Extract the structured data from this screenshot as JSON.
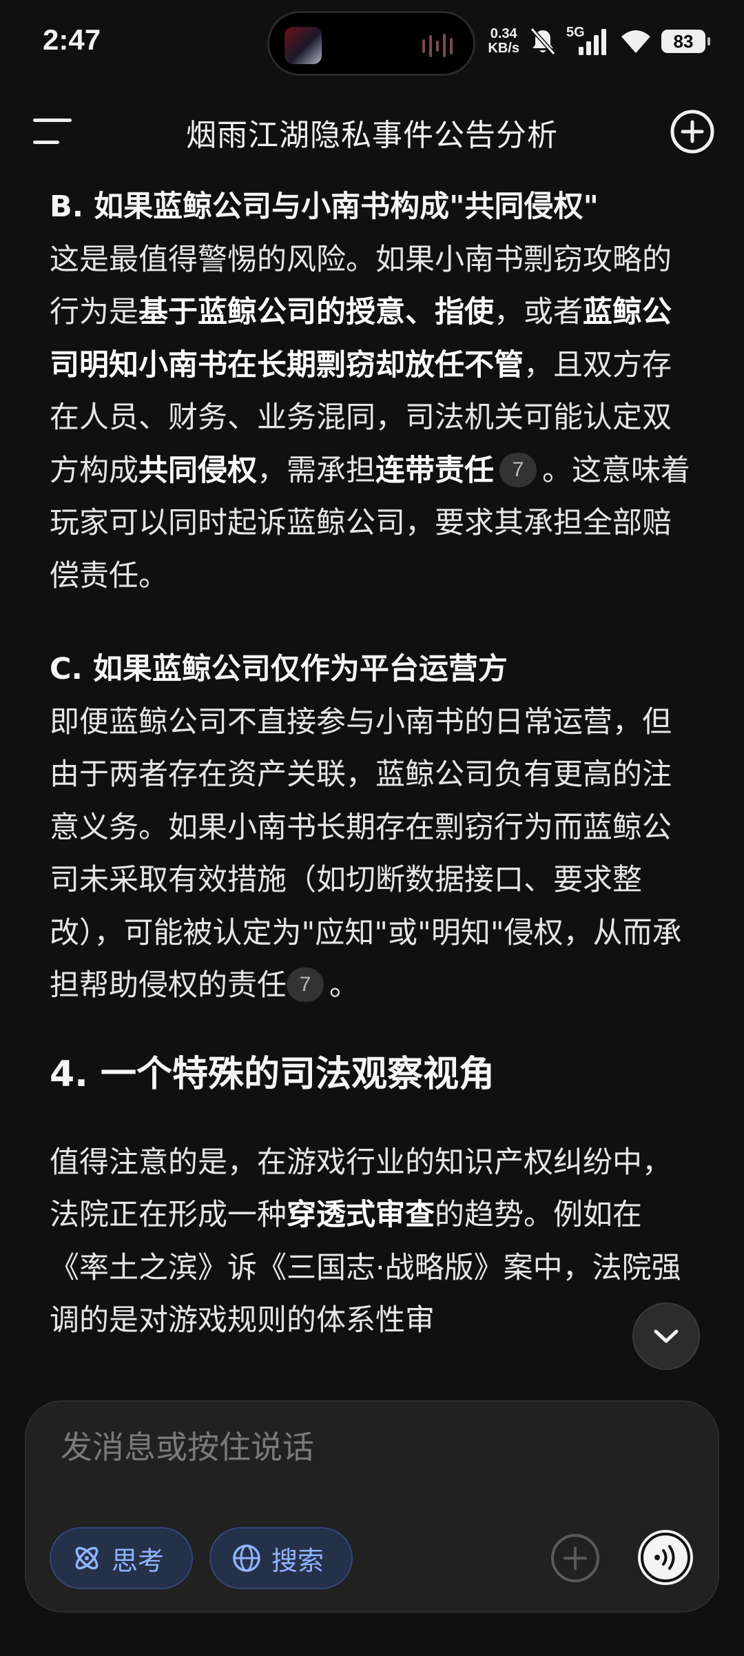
{
  "status_bar": {
    "time": "2:47",
    "net_speed_value": "0.34",
    "net_speed_unit": "KB/s",
    "network_type": "5G",
    "battery": "83"
  },
  "header": {
    "title": "烟雨江湖隐私事件公告分析"
  },
  "content": {
    "b": {
      "heading": "B. 如果蓝鲸公司与小南书构成\"共同侵权\"",
      "t1": "这是最值得警惕的风险。如果小南书剽窃攻略的行为是",
      "t2": "基于蓝鲸公司的授意、指使",
      "t3": "，或者",
      "t4": "蓝鲸公司明知小南书在长期剽窃却放任不管",
      "t5": "，且双方存在人员、财务、业务混同，司法机关可能认定双方构成",
      "t6": "共同侵权",
      "t7": "，需承担",
      "t8": "连带责任",
      "cite": "7",
      "t9": "。这意味着玩家可以同时起诉蓝鲸公司，要求其承担全部赔偿责任。"
    },
    "c": {
      "heading": "C. 如果蓝鲸公司仅作为平台运营方",
      "t1": "即便蓝鲸公司不直接参与小南书的日常运营，但由于两者存在资产关联，蓝鲸公司负有更高的注意义务。如果小南书长期存在剽窃行为而蓝鲸公司未采取有效措施（如切断数据接口、要求整改），可能被认定为\"应知\"或\"明知\"侵权，从而承担帮助侵权的责任",
      "cite": "7",
      "t2": "。"
    },
    "s4": {
      "heading": "4. 一个特殊的司法观察视角",
      "t1": "值得注意的是，在游戏行业的知识产权纠纷中，法院正在形成一种",
      "t2": "穿透式审查",
      "t3": "的趋势。例如在《率土之滨》诉《三国志·战略版》案中，法院强调的是对游戏规则的体系性审"
    }
  },
  "composer": {
    "placeholder": "发消息或按住说话",
    "think_label": "思考",
    "search_label": "搜索"
  }
}
